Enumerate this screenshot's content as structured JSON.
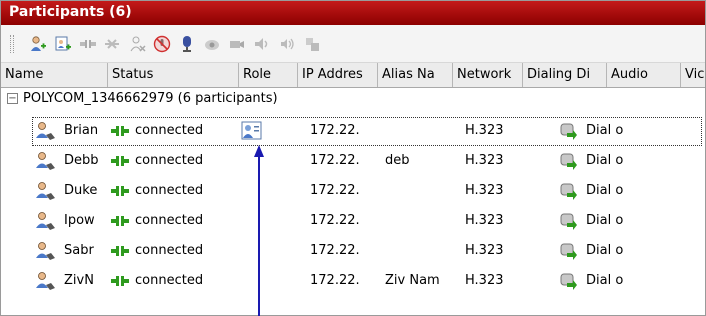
{
  "title": "Participants (6)",
  "toolbar": {
    "icons": [
      "add-participant-icon",
      "add-from-address-book-icon",
      "disconnect-icon",
      "delete-participant-icon",
      "participant-properties-icon",
      "mute-audio-icon",
      "mute-video-icon",
      "camera-icon",
      "video-block-icon",
      "audio-block-icon",
      "volume-icon",
      "settings-icon"
    ]
  },
  "columns": [
    "Name",
    "Status",
    "Role",
    "IP Addres",
    "Alias Na",
    "Network",
    "Dialing Di",
    "Audio",
    "Vic"
  ],
  "group": {
    "label": "POLYCOM_1346662979 (6 participants)"
  },
  "participants": [
    {
      "name": "Brian",
      "status": "connected",
      "role": "chairperson",
      "ip": "172.22.",
      "alias": "",
      "network": "H.323",
      "dialing": "Dial o"
    },
    {
      "name": "Debb",
      "status": "connected",
      "role": "",
      "ip": "172.22.",
      "alias": "deb",
      "network": "H.323",
      "dialing": "Dial o"
    },
    {
      "name": "Duke",
      "status": "connected",
      "role": "",
      "ip": "172.22.",
      "alias": "",
      "network": "H.323",
      "dialing": "Dial o"
    },
    {
      "name": "Ipow",
      "status": "connected",
      "role": "",
      "ip": "172.22.",
      "alias": "",
      "network": "H.323",
      "dialing": "Dial o"
    },
    {
      "name": "Sabr",
      "status": "connected",
      "role": "",
      "ip": "172.22.",
      "alias": "",
      "network": "H.323",
      "dialing": "Dial o"
    },
    {
      "name": "ZivN",
      "status": "connected",
      "role": "",
      "ip": "172.22.",
      "alias": "Ziv Nam",
      "network": "H.323",
      "dialing": "Dial o"
    }
  ],
  "colors": {
    "title_bg": "#b00000",
    "status_green": "#2e9a1e",
    "arrow": "#1a1ab0"
  }
}
